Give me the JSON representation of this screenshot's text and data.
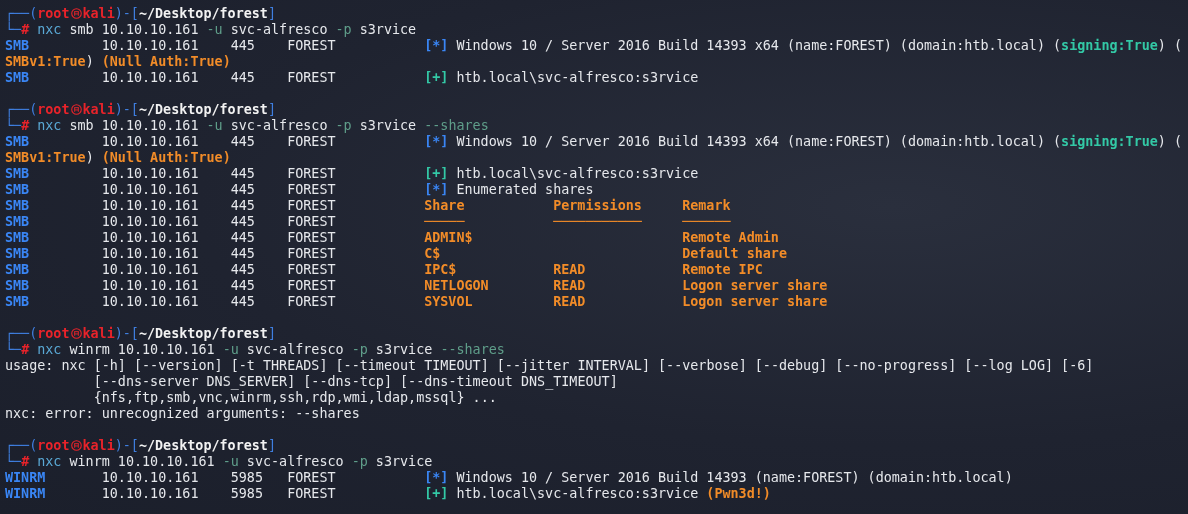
{
  "terminal": {
    "blocks": [
      {
        "prompt": {
          "frame_top": "┌──(",
          "user": "root",
          "host": "kali",
          "separator": ")-[",
          "path": "~/Desktop/forest",
          "close": "]",
          "frame_bottom": "└─",
          "symbol": "#"
        },
        "command": [
          {
            "text": "nxc",
            "kind": "command"
          },
          {
            "text": " smb 10.10.10.161 ",
            "kind": "arg"
          },
          {
            "text": "-u",
            "kind": "flag"
          },
          {
            "text": " svc-alfresco ",
            "kind": "arg"
          },
          {
            "text": "-p",
            "kind": "flag"
          },
          {
            "text": " s3rvice",
            "kind": "arg"
          }
        ],
        "output": [
          {
            "kind": "row",
            "protocol": "SMB",
            "ip": "10.10.10.161",
            "port": "445",
            "host": "FOREST",
            "message": [
              {
                "text": "[*]",
                "kind": "info"
              },
              {
                "text": " Windows 10 / Server 2016 Build 14393 x64 (name:FOREST) (domain:htb.local) (",
                "kind": "plain"
              },
              {
                "text": "signing:True",
                "kind": "good"
              },
              {
                "text": ") (",
                "kind": "plain"
              }
            ]
          },
          {
            "kind": "text",
            "segments": [
              {
                "text": "SMBv1:True",
                "kind": "warn"
              },
              {
                "text": ") ",
                "kind": "plain"
              },
              {
                "text": "(Null Auth:True)",
                "kind": "warn"
              }
            ]
          },
          {
            "kind": "row",
            "protocol": "SMB",
            "ip": "10.10.10.161",
            "port": "445",
            "host": "FOREST",
            "message": [
              {
                "text": "[+]",
                "kind": "ok"
              },
              {
                "text": " htb.local\\svc-alfresco:s3rvice",
                "kind": "plain"
              }
            ]
          }
        ]
      },
      {
        "prompt": {
          "frame_top": "┌──(",
          "user": "root",
          "host": "kali",
          "separator": ")-[",
          "path": "~/Desktop/forest",
          "close": "]",
          "frame_bottom": "└─",
          "symbol": "#"
        },
        "command": [
          {
            "text": "nxc",
            "kind": "command"
          },
          {
            "text": " smb 10.10.10.161 ",
            "kind": "arg"
          },
          {
            "text": "-u",
            "kind": "flag"
          },
          {
            "text": " svc-alfresco ",
            "kind": "arg"
          },
          {
            "text": "-p",
            "kind": "flag"
          },
          {
            "text": " s3rvice ",
            "kind": "arg"
          },
          {
            "text": "--shares",
            "kind": "flag"
          }
        ],
        "output": [
          {
            "kind": "row",
            "protocol": "SMB",
            "ip": "10.10.10.161",
            "port": "445",
            "host": "FOREST",
            "message": [
              {
                "text": "[*]",
                "kind": "info"
              },
              {
                "text": " Windows 10 / Server 2016 Build 14393 x64 (name:FOREST) (domain:htb.local) (",
                "kind": "plain"
              },
              {
                "text": "signing:True",
                "kind": "good"
              },
              {
                "text": ") (",
                "kind": "plain"
              }
            ]
          },
          {
            "kind": "text",
            "segments": [
              {
                "text": "SMBv1:True",
                "kind": "warn"
              },
              {
                "text": ") ",
                "kind": "plain"
              },
              {
                "text": "(Null Auth:True)",
                "kind": "warn"
              }
            ]
          },
          {
            "kind": "row",
            "protocol": "SMB",
            "ip": "10.10.10.161",
            "port": "445",
            "host": "FOREST",
            "message": [
              {
                "text": "[+]",
                "kind": "ok"
              },
              {
                "text": " htb.local\\svc-alfresco:s3rvice",
                "kind": "plain"
              }
            ]
          },
          {
            "kind": "row",
            "protocol": "SMB",
            "ip": "10.10.10.161",
            "port": "445",
            "host": "FOREST",
            "message": [
              {
                "text": "[*]",
                "kind": "info"
              },
              {
                "text": " Enumerated shares",
                "kind": "plain"
              }
            ]
          },
          {
            "kind": "row",
            "protocol": "SMB",
            "ip": "10.10.10.161",
            "port": "445",
            "host": "FOREST",
            "message": [
              {
                "text": "Share           Permissions     Remark",
                "kind": "warn"
              }
            ]
          },
          {
            "kind": "row",
            "protocol": "SMB",
            "ip": "10.10.10.161",
            "port": "445",
            "host": "FOREST",
            "message": [
              {
                "text": "─────           ───────────     ──────",
                "kind": "warn"
              }
            ]
          },
          {
            "kind": "row",
            "protocol": "SMB",
            "ip": "10.10.10.161",
            "port": "445",
            "host": "FOREST",
            "message": [
              {
                "text": "ADMIN$                          Remote Admin",
                "kind": "warn"
              }
            ]
          },
          {
            "kind": "row",
            "protocol": "SMB",
            "ip": "10.10.10.161",
            "port": "445",
            "host": "FOREST",
            "message": [
              {
                "text": "C$                              Default share",
                "kind": "warn"
              }
            ]
          },
          {
            "kind": "row",
            "protocol": "SMB",
            "ip": "10.10.10.161",
            "port": "445",
            "host": "FOREST",
            "message": [
              {
                "text": "IPC$            READ            Remote IPC",
                "kind": "warn"
              }
            ]
          },
          {
            "kind": "row",
            "protocol": "SMB",
            "ip": "10.10.10.161",
            "port": "445",
            "host": "FOREST",
            "message": [
              {
                "text": "NETLOGON        READ            Logon server share",
                "kind": "warn"
              }
            ]
          },
          {
            "kind": "row",
            "protocol": "SMB",
            "ip": "10.10.10.161",
            "port": "445",
            "host": "FOREST",
            "message": [
              {
                "text": "SYSVOL          READ            Logon server share",
                "kind": "warn"
              }
            ]
          }
        ]
      },
      {
        "prompt": {
          "frame_top": "┌──(",
          "user": "root",
          "host": "kali",
          "separator": ")-[",
          "path": "~/Desktop/forest",
          "close": "]",
          "frame_bottom": "└─",
          "symbol": "#"
        },
        "command": [
          {
            "text": "nxc",
            "kind": "command"
          },
          {
            "text": " winrm 10.10.10.161 ",
            "kind": "arg"
          },
          {
            "text": "-u",
            "kind": "flag"
          },
          {
            "text": " svc-alfresco ",
            "kind": "arg"
          },
          {
            "text": "-p",
            "kind": "flag"
          },
          {
            "text": " s3rvice ",
            "kind": "arg"
          },
          {
            "text": "--shares",
            "kind": "flag"
          }
        ],
        "output": [
          {
            "kind": "text",
            "segments": [
              {
                "text": "usage: nxc [-h] [--version] [-t THREADS] [--timeout TIMEOUT] [--jitter INTERVAL] [--verbose] [--debug] [--no-progress] [--log LOG] [-6]",
                "kind": "plain"
              }
            ]
          },
          {
            "kind": "text",
            "segments": [
              {
                "text": "           [--dns-server DNS_SERVER] [--dns-tcp] [--dns-timeout DNS_TIMEOUT]",
                "kind": "plain"
              }
            ]
          },
          {
            "kind": "text",
            "segments": [
              {
                "text": "           {nfs,ftp,smb,vnc,winrm,ssh,rdp,wmi,ldap,mssql} ...",
                "kind": "plain"
              }
            ]
          },
          {
            "kind": "text",
            "segments": [
              {
                "text": "nxc: error: unrecognized arguments: --shares",
                "kind": "plain"
              }
            ]
          }
        ]
      },
      {
        "prompt": {
          "frame_top": "┌──(",
          "user": "root",
          "host": "kali",
          "separator": ")-[",
          "path": "~/Desktop/forest",
          "close": "]",
          "frame_bottom": "└─",
          "symbol": "#"
        },
        "command": [
          {
            "text": "nxc",
            "kind": "command"
          },
          {
            "text": " winrm 10.10.10.161 ",
            "kind": "arg"
          },
          {
            "text": "-u",
            "kind": "flag"
          },
          {
            "text": " svc-alfresco ",
            "kind": "arg"
          },
          {
            "text": "-p",
            "kind": "flag"
          },
          {
            "text": " s3rvice",
            "kind": "arg"
          }
        ],
        "output": [
          {
            "kind": "row",
            "protocol": "WINRM",
            "ip": "10.10.10.161",
            "port": "5985",
            "host": "FOREST",
            "message": [
              {
                "text": "[*]",
                "kind": "info"
              },
              {
                "text": " Windows 10 / Server 2016 Build 14393 (name:FOREST) (domain:htb.local)",
                "kind": "plain"
              }
            ]
          },
          {
            "kind": "row",
            "protocol": "WINRM",
            "ip": "10.10.10.161",
            "port": "5985",
            "host": "FOREST",
            "message": [
              {
                "text": "[+]",
                "kind": "ok"
              },
              {
                "text": " htb.local\\svc-alfresco:s3rvice ",
                "kind": "plain"
              },
              {
                "text": "(Pwn3d!)",
                "kind": "warn"
              }
            ]
          }
        ]
      }
    ]
  }
}
